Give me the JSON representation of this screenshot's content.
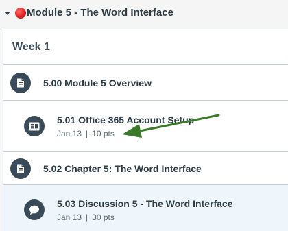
{
  "module": {
    "title": "Module 5 - The Word Interface"
  },
  "week": {
    "title": "Week 1"
  },
  "items": [
    {
      "title": "5.00 Module 5 Overview",
      "icon": "document-icon"
    },
    {
      "title": "5.01 Office 365 Account Setup",
      "date": "Jan 13",
      "separator": "|",
      "points": "10 pts",
      "icon": "assignment-icon"
    },
    {
      "title": "5.02 Chapter 5: The Word Interface",
      "icon": "document-icon"
    },
    {
      "title": "5.03 Discussion 5 - The Word Interface",
      "date": "Jan 13",
      "separator": "|",
      "points": "30 pts",
      "icon": "discussion-icon"
    }
  ],
  "colors": {
    "accent_arrow": "#3a7a2a",
    "status_dot": "#e0201f",
    "highlight_row": "#eef6fb",
    "icon_bg": "#394b58"
  }
}
